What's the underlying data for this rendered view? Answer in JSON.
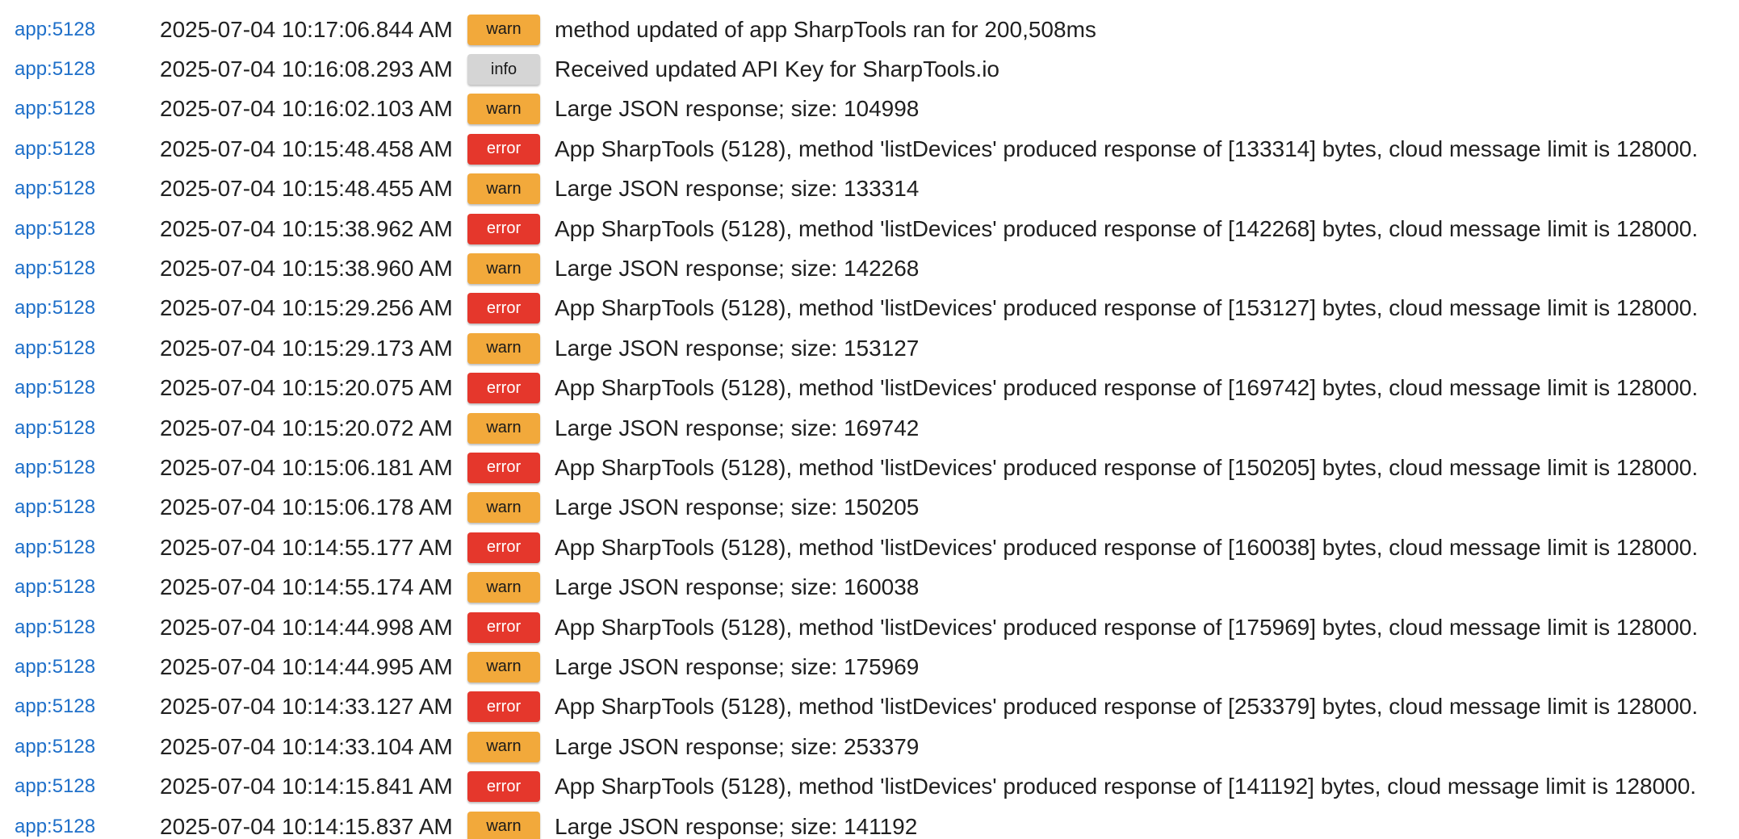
{
  "log": {
    "colors": {
      "warn": "#f2a93b",
      "info": "#d5d5d5",
      "error": "#e5372c",
      "source_link": "#1e6fc9"
    },
    "rows": [
      {
        "source": "app:5128",
        "time": "2025-07-04 10:17:06.844 AM",
        "level": "warn",
        "message": "method updated of app SharpTools ran for 200,508ms"
      },
      {
        "source": "app:5128",
        "time": "2025-07-04 10:16:08.293 AM",
        "level": "info",
        "message": "Received updated API Key for SharpTools.io"
      },
      {
        "source": "app:5128",
        "time": "2025-07-04 10:16:02.103 AM",
        "level": "warn",
        "message": "Large JSON response; size: 104998"
      },
      {
        "source": "app:5128",
        "time": "2025-07-04 10:15:48.458 AM",
        "level": "error",
        "message": "App SharpTools (5128), method 'listDevices' produced response of [133314] bytes, cloud message limit is 128000."
      },
      {
        "source": "app:5128",
        "time": "2025-07-04 10:15:48.455 AM",
        "level": "warn",
        "message": "Large JSON response; size: 133314"
      },
      {
        "source": "app:5128",
        "time": "2025-07-04 10:15:38.962 AM",
        "level": "error",
        "message": "App SharpTools (5128), method 'listDevices' produced response of [142268] bytes, cloud message limit is 128000."
      },
      {
        "source": "app:5128",
        "time": "2025-07-04 10:15:38.960 AM",
        "level": "warn",
        "message": "Large JSON response; size: 142268"
      },
      {
        "source": "app:5128",
        "time": "2025-07-04 10:15:29.256 AM",
        "level": "error",
        "message": "App SharpTools (5128), method 'listDevices' produced response of [153127] bytes, cloud message limit is 128000."
      },
      {
        "source": "app:5128",
        "time": "2025-07-04 10:15:29.173 AM",
        "level": "warn",
        "message": "Large JSON response; size: 153127"
      },
      {
        "source": "app:5128",
        "time": "2025-07-04 10:15:20.075 AM",
        "level": "error",
        "message": "App SharpTools (5128), method 'listDevices' produced response of [169742] bytes, cloud message limit is 128000."
      },
      {
        "source": "app:5128",
        "time": "2025-07-04 10:15:20.072 AM",
        "level": "warn",
        "message": "Large JSON response; size: 169742"
      },
      {
        "source": "app:5128",
        "time": "2025-07-04 10:15:06.181 AM",
        "level": "error",
        "message": "App SharpTools (5128), method 'listDevices' produced response of [150205] bytes, cloud message limit is 128000."
      },
      {
        "source": "app:5128",
        "time": "2025-07-04 10:15:06.178 AM",
        "level": "warn",
        "message": "Large JSON response; size: 150205"
      },
      {
        "source": "app:5128",
        "time": "2025-07-04 10:14:55.177 AM",
        "level": "error",
        "message": "App SharpTools (5128), method 'listDevices' produced response of [160038] bytes, cloud message limit is 128000."
      },
      {
        "source": "app:5128",
        "time": "2025-07-04 10:14:55.174 AM",
        "level": "warn",
        "message": "Large JSON response; size: 160038"
      },
      {
        "source": "app:5128",
        "time": "2025-07-04 10:14:44.998 AM",
        "level": "error",
        "message": "App SharpTools (5128), method 'listDevices' produced response of [175969] bytes, cloud message limit is 128000."
      },
      {
        "source": "app:5128",
        "time": "2025-07-04 10:14:44.995 AM",
        "level": "warn",
        "message": "Large JSON response; size: 175969"
      },
      {
        "source": "app:5128",
        "time": "2025-07-04 10:14:33.127 AM",
        "level": "error",
        "message": "App SharpTools (5128), method 'listDevices' produced response of [253379] bytes, cloud message limit is 128000."
      },
      {
        "source": "app:5128",
        "time": "2025-07-04 10:14:33.104 AM",
        "level": "warn",
        "message": "Large JSON response; size: 253379"
      },
      {
        "source": "app:5128",
        "time": "2025-07-04 10:14:15.841 AM",
        "level": "error",
        "message": "App SharpTools (5128), method 'listDevices' produced response of [141192] bytes, cloud message limit is 128000."
      },
      {
        "source": "app:5128",
        "time": "2025-07-04 10:14:15.837 AM",
        "level": "warn",
        "message": "Large JSON response; size: 141192"
      }
    ]
  }
}
